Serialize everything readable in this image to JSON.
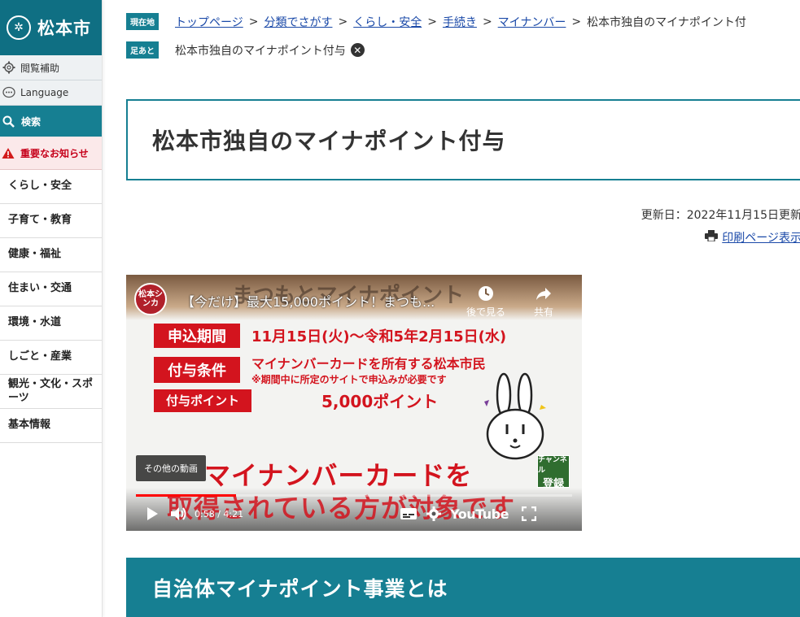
{
  "sidebar": {
    "logo_text": "松本市",
    "accessibility": "閲覧補助",
    "language": "Language",
    "search": "検索",
    "notice": "重要なお知らせ",
    "nav": [
      "くらし・安全",
      "子育て・教育",
      "健康・福祉",
      "住まい・交通",
      "環境・水道",
      "しごと・産業",
      "観光・文化・スポーツ",
      "基本情報"
    ]
  },
  "breadcrumb": {
    "current_tag": "現在地",
    "items": [
      "トップページ",
      "分類でさがす",
      "くらし・安全",
      "手続き",
      "マイナンバー"
    ],
    "current": "松本市独自のマイナポイント付",
    "footprint_tag": "足あと",
    "footprint_item": "松本市独自のマイナポイント付与"
  },
  "page": {
    "title": "松本市独自のマイナポイント付与",
    "updated": "更新日：2022年11月15日更新",
    "print": "印刷ページ表示"
  },
  "video": {
    "channel": "松本シンカ",
    "title": "【今だけ】最大15,000ポイント！まつも...",
    "watch_later": "後で見る",
    "share": "共有",
    "banner": "まつもとマイナポイント",
    "row1_label": "申込期間",
    "row1_text": "11月15日(火)〜令和5年2月15日(水)",
    "row2_label": "付与条件",
    "row2_text": "マイナンバーカードを所有する松本市民",
    "row2_sub": "※期間中に所定のサイトで申込みが必要です",
    "row3_label": "付与ポイント",
    "row3_text": "5,000ポイント",
    "bottom1": "マイナンバーカードを",
    "bottom2": "取得されている方が対象です",
    "more_videos": "その他の動画",
    "subscribe_top": "チャンネル",
    "subscribe": "登録",
    "time": "0:58 / 4:21",
    "youtube": "YouTube",
    "progress": 0.229
  },
  "section": {
    "heading": "自治体マイナポイント事業とは"
  }
}
